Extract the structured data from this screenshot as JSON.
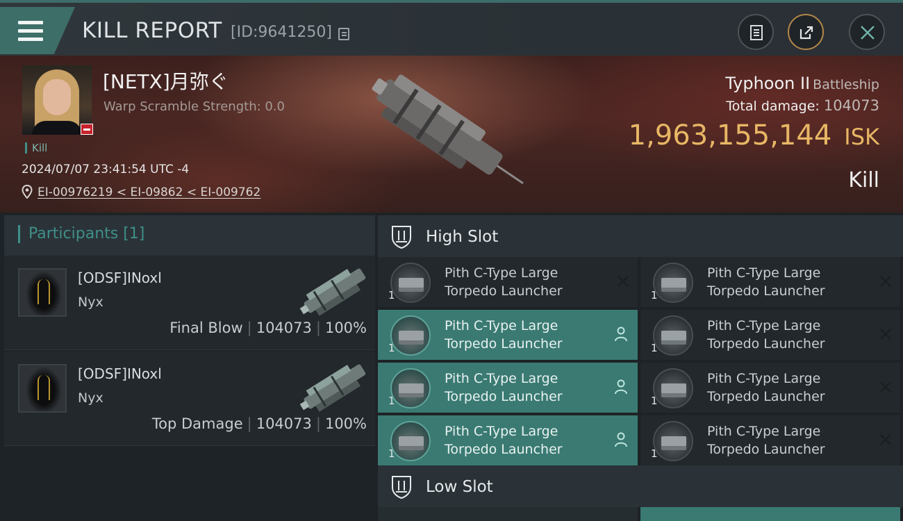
{
  "header": {
    "title": "KILL REPORT",
    "report_id": "[ID:9641250]"
  },
  "victim": {
    "name": "[NETX]月弥ぐ",
    "scramble": "Warp Scramble Strength: 0.0",
    "tag": "Kill",
    "datetime": "2024/07/07 23:41:54 UTC -4",
    "location": "EI-00976219 < EI-09862 < EI-009762"
  },
  "ship": {
    "name": "Typhoon II",
    "class": "Battleship",
    "total_damage_label": "Total damage:",
    "total_damage": "104073",
    "isk_value": "1,963,155,144",
    "isk_unit": "ISK",
    "result": "Kill"
  },
  "participants": {
    "header": "Participants [1]",
    "rows": [
      {
        "name": "[ODSF]INoxl",
        "ship": "Nyx",
        "role": "Final Blow",
        "damage": "104073",
        "percent": "100%"
      },
      {
        "name": "[ODSF]INoxl",
        "ship": "Nyx",
        "role": "Top Damage",
        "damage": "104073",
        "percent": "100%"
      }
    ]
  },
  "slots": {
    "high_label": "High Slot",
    "low_label": "Low Slot",
    "high_modules": [
      {
        "line1": "Pith C-Type Large",
        "line2": "Torpedo Launcher",
        "qty": "1"
      },
      {
        "line1": "Pith C-Type Large",
        "line2": "Torpedo Launcher",
        "qty": "1"
      },
      {
        "line1": "Pith C-Type Large",
        "line2": "Torpedo Launcher",
        "qty": "1"
      },
      {
        "line1": "Pith C-Type Large",
        "line2": "Torpedo Launcher",
        "qty": "1"
      },
      {
        "line1": "Pith C-Type Large",
        "line2": "Torpedo Launcher",
        "qty": "1"
      },
      {
        "line1": "Pith C-Type Large",
        "line2": "Torpedo Launcher",
        "qty": "1"
      },
      {
        "line1": "Pith C-Type Large",
        "line2": "Torpedo Launcher",
        "qty": "1"
      },
      {
        "line1": "Pith C-Type Large",
        "line2": "Torpedo Launcher",
        "qty": "1"
      }
    ]
  },
  "colors": {
    "accent_teal": "#3a7a72",
    "isk_gold": "#e8b765",
    "badge_red": "#c8232b"
  },
  "icons": [
    "menu-icon",
    "copy-icon",
    "clipboard-icon",
    "share-icon",
    "close-icon",
    "location-pin-icon",
    "slot-icon",
    "destroyed-x-icon",
    "pilot-icon"
  ]
}
